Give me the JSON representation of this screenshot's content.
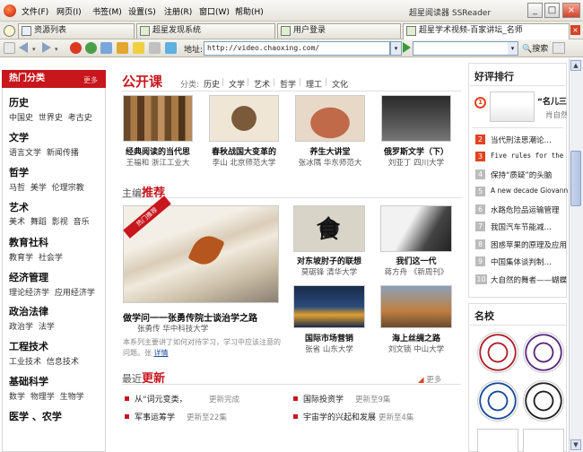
{
  "window": {
    "title": "超星阅读器 SSReader",
    "menus": [
      "文件(F)",
      "网页(I)",
      "书签(M)",
      "设置(S)",
      "注册(R)",
      "窗口(W)",
      "帮助(H)"
    ],
    "buttons": {
      "min": "_",
      "max": "□",
      "close": "×"
    }
  },
  "tabs": [
    "资源列表",
    "超星发现系统",
    "用户登录",
    "超星学术视频-百家讲坛_名师"
  ],
  "address": {
    "label": "地址:",
    "url": "http://video.chaoxing.com/"
  },
  "search": {
    "label": "搜索"
  },
  "sidebar": {
    "title": "热门分类",
    "more": "更多",
    "categories": [
      {
        "name": "历史",
        "subs": "中国史 世界史 考古史"
      },
      {
        "name": "文学",
        "subs": "语言文学 新闻传播"
      },
      {
        "name": "哲学",
        "subs": "马哲 美学 伦理宗教"
      },
      {
        "name": "艺术",
        "subs": "美术 舞蹈 影视 音乐"
      },
      {
        "name": "教育社科",
        "subs": "教育学 社会学"
      },
      {
        "name": "经济管理",
        "subs": "理论经济学 应用经济学"
      },
      {
        "name": "政治法律",
        "subs": "政治学 法学"
      },
      {
        "name": "工程技术",
        "subs": "工业技术 信息技术"
      },
      {
        "name": "基础科学",
        "subs": "数学 物理学 生物学"
      },
      {
        "name": "医学 、农学",
        "subs": ""
      }
    ]
  },
  "open_course": {
    "title": "公开课",
    "filter_label": "分类:",
    "filters": [
      "历史",
      "文学",
      "艺术",
      "哲学",
      "理工",
      "文化"
    ],
    "items": [
      {
        "title": "经典阅读的当代思",
        "meta": "王福和 浙江工业大"
      },
      {
        "title": "春秋战国大变革的",
        "meta": "李山 北京师范大学"
      },
      {
        "title": "养生大讲堂",
        "meta": "张冰隅 华东师范大"
      },
      {
        "title": "俄罗斯文学（下）",
        "meta": "刘亚丁 四川大学"
      }
    ]
  },
  "featured": {
    "title_prefix": "主编",
    "title_highlight": "推荐",
    "ribbon": "热门推荐",
    "main": {
      "title": "做学问一一张勇传院士谈治学之路",
      "meta": "张勇传 华中科技大学",
      "desc": "本系列主要讲了如何对待学习，学习中应该注意的问题。张",
      "desc_link": "详情"
    },
    "items": [
      {
        "title": "对东坡肘子的联想",
        "meta": "莫砺锋 清华大学"
      },
      {
        "title": "我们这一代",
        "meta": "蒋方舟 《新周刊》"
      },
      {
        "title": "国际市场营销",
        "meta": "张省 山东大学"
      },
      {
        "title": "海上丝绸之路",
        "meta": "刘文锁 中山大学"
      }
    ]
  },
  "latest": {
    "title_prefix": "最近",
    "title_highlight": "更新",
    "more": "更多",
    "items": [
      {
        "title": "从“词元变类，",
        "meta": "更新完成"
      },
      {
        "title": "国际投资学",
        "meta": "更新至9集"
      },
      {
        "title": "军事运筹学",
        "meta": "更新至22集"
      },
      {
        "title": "宇宙学的兴起和发展",
        "meta": "更新至4集"
      }
    ]
  },
  "ranking": {
    "title": "好评排行",
    "top": {
      "title": "“名儿三",
      "meta": "肖自然"
    },
    "items": [
      "当代刑法思潮论…",
      "Five rules for the ev",
      "保持“质疑”的头脑",
      "A new decade Giovanni",
      "水路危险品运输管理",
      "我国汽车节能减…",
      "困惑苹果的原理及应用",
      "中国集体谈判制…",
      "大自然的舞者——蝴蝶"
    ]
  },
  "schools": {
    "title": "名校"
  }
}
